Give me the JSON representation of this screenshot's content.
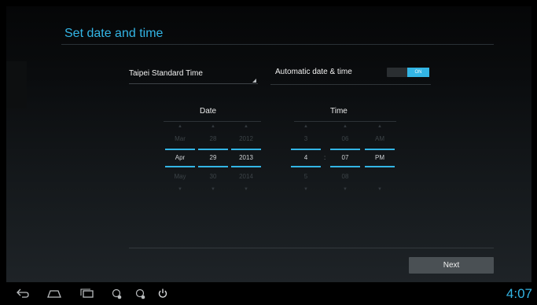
{
  "title": "Set date and time",
  "timezone": {
    "value": "Taipei Standard Time"
  },
  "auto_time": {
    "label": "Automatic date & time",
    "toggle_label": "ON",
    "enabled": true
  },
  "date_picker": {
    "title": "Date",
    "month": {
      "prev": "Mar",
      "current": "Apr",
      "next": "May"
    },
    "day": {
      "prev": "28",
      "current": "29",
      "next": "30"
    },
    "year": {
      "prev": "2012",
      "current": "2013",
      "next": "2014"
    }
  },
  "time_picker": {
    "title": "Time",
    "separator": ":",
    "hour": {
      "prev": "3",
      "current": "4",
      "next": "5"
    },
    "minute": {
      "prev": "06",
      "current": "07",
      "next": "08"
    },
    "ampm": {
      "prev": "AM",
      "current": "PM",
      "next": ""
    }
  },
  "next_button": "Next",
  "status_bar": {
    "clock": "4:07"
  },
  "nav_icons": [
    "back-icon",
    "home-icon",
    "recent-apps-icon",
    "usb-debug-icon",
    "usb-icon",
    "power-icon"
  ],
  "colors": {
    "accent": "#33b5e5",
    "background": "#000000"
  }
}
